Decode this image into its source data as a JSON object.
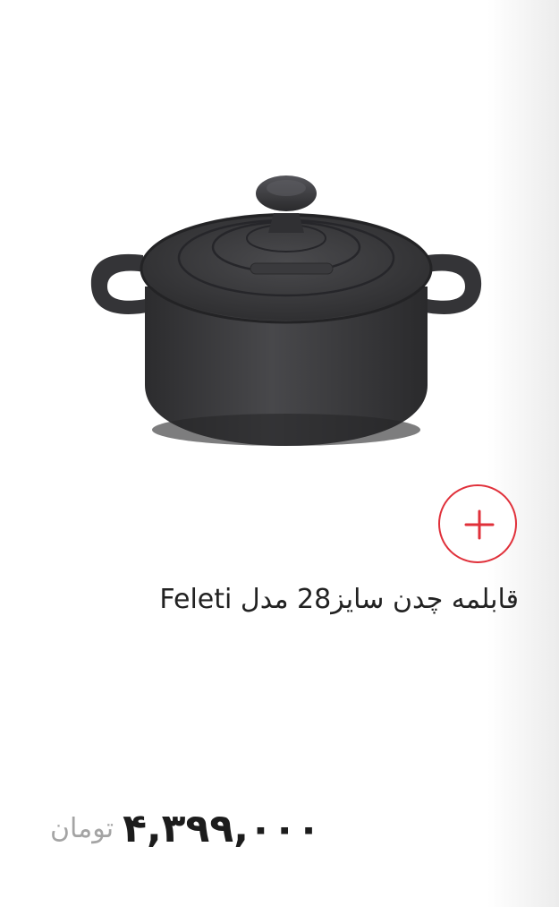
{
  "product": {
    "title": "قابلمه چدن سایز28 مدل Feleti",
    "price": "۴,۳۹۹,۰۰۰",
    "currency": "تومان",
    "image_icon": "cast-iron-pot-image",
    "add_icon": "plus-icon"
  },
  "colors": {
    "accent": "#e0303a",
    "price_text": "#1c1c1c",
    "currency_text": "#a4a4a4"
  }
}
